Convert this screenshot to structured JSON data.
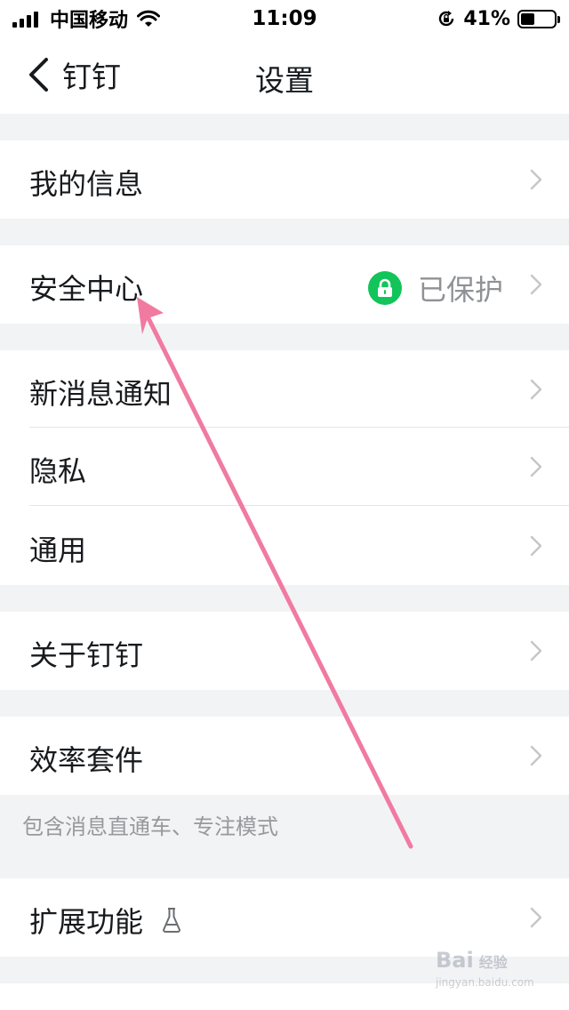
{
  "status_bar": {
    "carrier": "中国移动",
    "time": "11:09",
    "battery_percent": "41%",
    "battery_level": 0.41
  },
  "nav": {
    "back_label": "钉钉",
    "title": "设置"
  },
  "rows": [
    {
      "label": "我的信息"
    },
    {
      "label": "安全中心",
      "value": "已保护"
    },
    {
      "label": "新消息通知"
    },
    {
      "label": "隐私"
    },
    {
      "label": "通用"
    },
    {
      "label": "关于钉钉"
    },
    {
      "label": "效率套件"
    },
    {
      "label": "扩展功能"
    }
  ],
  "notes": {
    "efficiency_suite": "包含消息直通车、专注模式"
  },
  "watermark": {
    "brand": "Bai",
    "brand_cn": "经验",
    "url": "jingyan.baidu.com"
  },
  "colors": {
    "accent_green": "#12c45a",
    "annotation_arrow": "#f07aa0"
  },
  "icons": {
    "back": "chevron-left-icon",
    "row_arrow": "chevron-right-icon",
    "security": "lock-icon",
    "beta": "flask-icon"
  }
}
